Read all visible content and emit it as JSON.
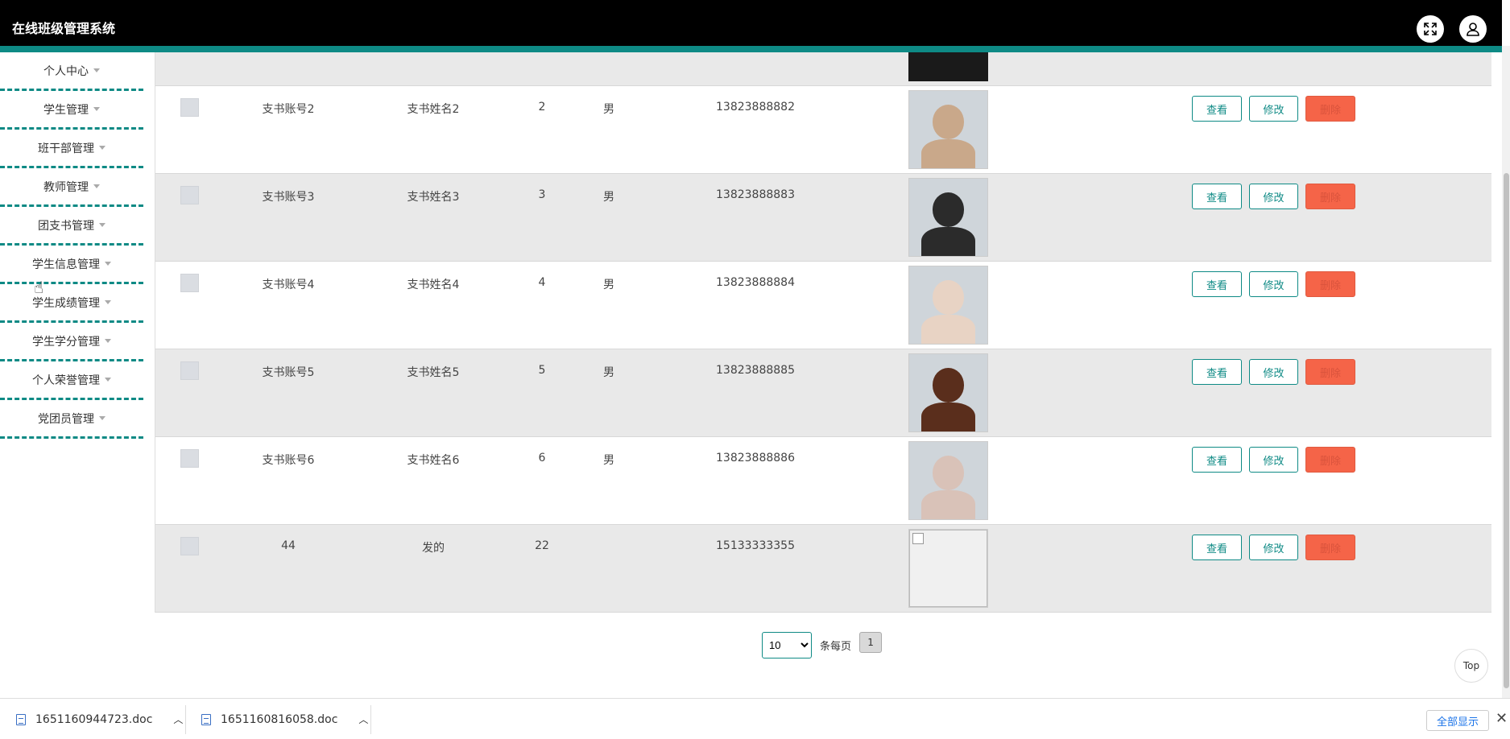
{
  "header": {
    "title": "在线班级管理系统",
    "fullscreen_icon": "expand-icon",
    "user_icon": "user-icon"
  },
  "sidebar": {
    "items": [
      {
        "label": "个人中心"
      },
      {
        "label": "学生管理"
      },
      {
        "label": "班干部管理"
      },
      {
        "label": "教师管理"
      },
      {
        "label": "团支书管理"
      },
      {
        "label": "学生信息管理"
      },
      {
        "label": "学生成绩管理"
      },
      {
        "label": "学生学分管理"
      },
      {
        "label": "个人荣誉管理"
      },
      {
        "label": "党团员管理"
      }
    ]
  },
  "table": {
    "rows": [
      {
        "account": "支书账号2",
        "name": "支书姓名2",
        "no": "2",
        "sex": "男",
        "phone": "13823888882",
        "photo": "photo-girl-cap",
        "color": "#c9a88a"
      },
      {
        "account": "支书账号3",
        "name": "支书姓名3",
        "no": "3",
        "sex": "男",
        "phone": "13823888883",
        "photo": "photo-boy",
        "color": "#2b2b2b"
      },
      {
        "account": "支书账号4",
        "name": "支书姓名4",
        "no": "4",
        "sex": "男",
        "phone": "13823888884",
        "photo": "photo-girl",
        "color": "#e8d3c4"
      },
      {
        "account": "支书账号5",
        "name": "支书姓名5",
        "no": "5",
        "sex": "男",
        "phone": "13823888885",
        "photo": "photo-man",
        "color": "#5a2e1c"
      },
      {
        "account": "支书账号6",
        "name": "支书姓名6",
        "no": "6",
        "sex": "男",
        "phone": "13823888886",
        "photo": "photo-girl-lying",
        "color": "#d9c2b8"
      },
      {
        "account": "44",
        "name": "发的",
        "no": "22",
        "sex": "",
        "phone": "15133333355",
        "photo": "broken-image",
        "color": ""
      }
    ],
    "actions": {
      "view": "查看",
      "edit": "修改",
      "delete": "删除"
    }
  },
  "pagination": {
    "page_size": "10",
    "per_page_label": "条每页",
    "current_page": "1",
    "options": [
      "10"
    ]
  },
  "top_button": "Top",
  "downloads": {
    "items": [
      {
        "filename": "1651160944723.doc"
      },
      {
        "filename": "1651160816058.doc"
      }
    ],
    "show_all": "全部显示"
  },
  "colors": {
    "accent": "#0e8a85",
    "danger": "#f56448",
    "header": "#000000"
  }
}
